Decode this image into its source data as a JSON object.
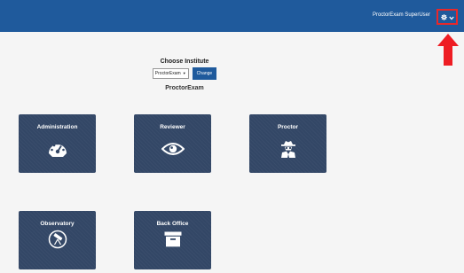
{
  "header": {
    "user_name": "ProctorExam SuperUser",
    "settings_icon": "gear-icon",
    "dropdown_icon": "chevron-down-icon",
    "highlight_color": "#e8282a",
    "bar_color": "#1f5a9c"
  },
  "institute": {
    "title": "Choose Institute",
    "selected": "ProctorExam",
    "change_label": "Change",
    "current_name": "ProctorExam"
  },
  "tiles": [
    {
      "label": "Administration",
      "icon": "dashboard-gauge-icon"
    },
    {
      "label": "Reviewer",
      "icon": "eye-icon"
    },
    {
      "label": "Proctor",
      "icon": "spy-agent-icon"
    },
    {
      "label": "Observatory",
      "icon": "telescope-icon"
    },
    {
      "label": "Back Office",
      "icon": "archive-box-icon"
    }
  ],
  "colors": {
    "tile": "#334766",
    "background": "#f5f5f5"
  }
}
